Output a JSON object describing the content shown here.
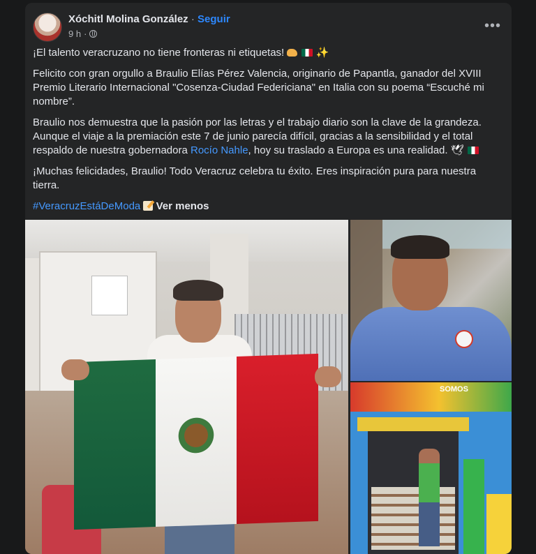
{
  "post": {
    "author": "Xóchitl Molina González",
    "separator": "·",
    "follow_label": "Seguir",
    "time": "9 h",
    "time_dot": "·",
    "more_label": "•••",
    "paragraphs": {
      "p1": "¡El talento veracruzano no tiene fronteras ni etiquetas!",
      "p2": "Felicito con gran orgullo a Braulio Elías Pérez Valencia, originario de Papantla, ganador del XVIII Premio Literario Internacional \"Cosenza-Ciudad Federiciana\" en Italia con su poema “Escuché mi nombre”.",
      "p3_before": "Braulio nos demuestra que la pasión por las letras y el trabajo diario son la clave de la grandeza. Aunque el viaje a la premiación este 7 de junio parecía difícil, gracias a la sensibilidad y el total respaldo de nuestra gobernadora ",
      "p3_mention": "Rocío Nahle",
      "p3_after": ", hoy su traslado a Europa es una realidad.",
      "p4": "¡Muchas felicidades, Braulio! Todo Veracruz celebra tu éxito. Eres inspiración pura para nuestra tierra."
    },
    "hashtag": "#VeracruzEstáDeModa",
    "see_less": "Ver menos",
    "photo3_sign_text": "SOMOS"
  },
  "icons": {
    "more": "more-horizontal-icon",
    "privacy": "globe-icon",
    "emoji_muscle": "flexed-biceps-emoji",
    "emoji_flag": "mexico-flag-emoji",
    "emoji_sparkles": "sparkles-emoji",
    "emoji_dove": "dove-emoji",
    "emoji_memo": "memo-emoji"
  },
  "colors": {
    "background": "#18191a",
    "card": "#242526",
    "text": "#e4e6eb",
    "secondary": "#b0b3b8",
    "link": "#4599ff",
    "follow": "#2d88ff"
  }
}
